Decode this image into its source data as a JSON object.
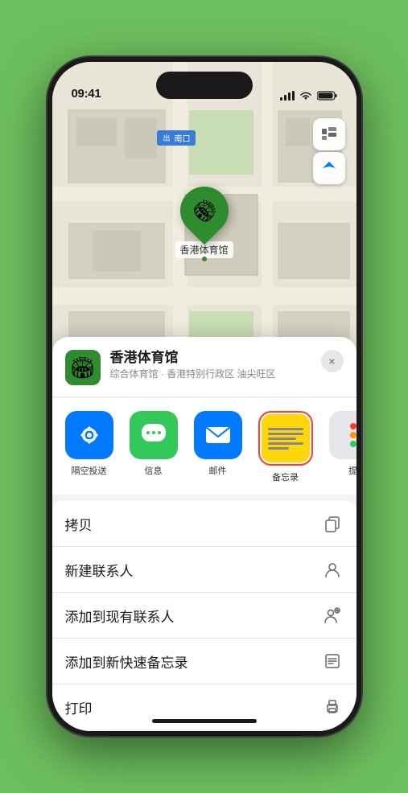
{
  "status_bar": {
    "time": "09:41",
    "location_arrow": "▶"
  },
  "map": {
    "exit_label": "南口",
    "pin_label": "香港体育馆"
  },
  "location_header": {
    "name": "香港体育馆",
    "description": "综合体育馆 · 香港特别行政区 油尖旺区",
    "close_label": "×"
  },
  "share_apps": [
    {
      "id": "airdrop",
      "label": "隔空投送"
    },
    {
      "id": "messages",
      "label": "信息"
    },
    {
      "id": "mail",
      "label": "邮件"
    },
    {
      "id": "notes",
      "label": "备忘录"
    },
    {
      "id": "more",
      "label": "提"
    }
  ],
  "actions": [
    {
      "id": "copy",
      "label": "拷贝",
      "icon": "copy"
    },
    {
      "id": "new-contact",
      "label": "新建联系人",
      "icon": "person"
    },
    {
      "id": "add-contact",
      "label": "添加到现有联系人",
      "icon": "person-add"
    },
    {
      "id": "quick-note",
      "label": "添加到新快速备忘录",
      "icon": "note"
    },
    {
      "id": "print",
      "label": "打印",
      "icon": "print"
    }
  ]
}
